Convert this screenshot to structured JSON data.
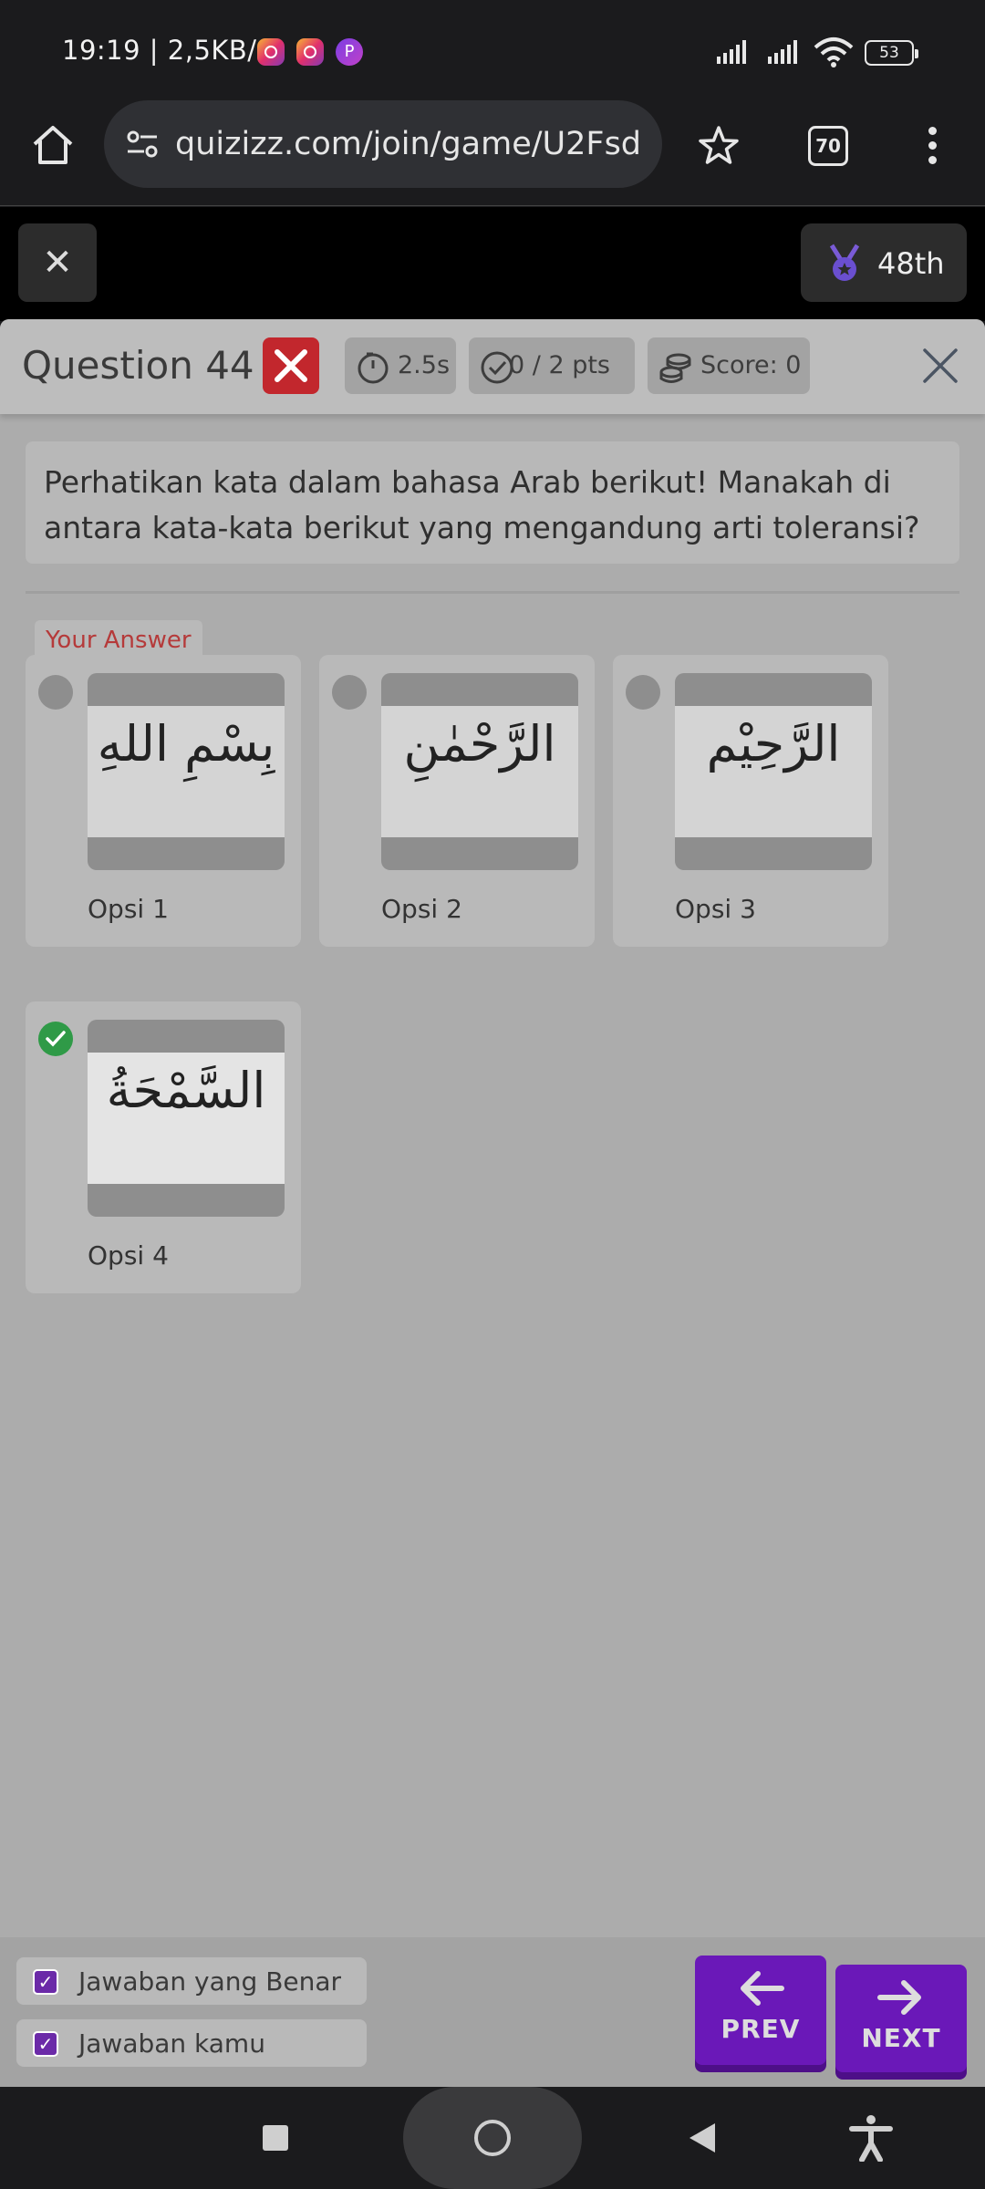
{
  "status_bar": {
    "time": "19:19 | 2,5KB/d",
    "battery": "53",
    "notif_icons": [
      "instagram-icon",
      "instagram-icon",
      "picsart-icon"
    ]
  },
  "browser": {
    "url": "quizizz.com/join/game/U2Fsd",
    "tab_count": "70"
  },
  "game_header": {
    "rank": "48th"
  },
  "question": {
    "title": "Question 44",
    "timer": "2.5s",
    "points": "0 / 2 pts",
    "score": "Score: 0",
    "text": "Perhatikan kata dalam bahasa Arab berikut! Manakah di antara kata-kata berikut yang mengandung arti toleransi?",
    "your_answer_label": "Your Answer"
  },
  "options": [
    {
      "label": "Opsi 1",
      "arabic": "بِسْمِ اللهِ",
      "correct": false
    },
    {
      "label": "Opsi 2",
      "arabic": "الرَّحْمٰنِ",
      "correct": false
    },
    {
      "label": "Opsi 3",
      "arabic": "الرَّحِيْم",
      "correct": false
    },
    {
      "label": "Opsi 4",
      "arabic": "السَّمْحَةُ",
      "correct": true
    }
  ],
  "footer": {
    "correct_answer_label": "Jawaban yang Benar",
    "your_answer_label": "Jawaban kamu",
    "prev_label": "PREV",
    "next_label": "NEXT"
  },
  "colors": {
    "wrong": "#c2272d",
    "correct": "#2f9a47",
    "nav_button": "#6a18b8"
  }
}
